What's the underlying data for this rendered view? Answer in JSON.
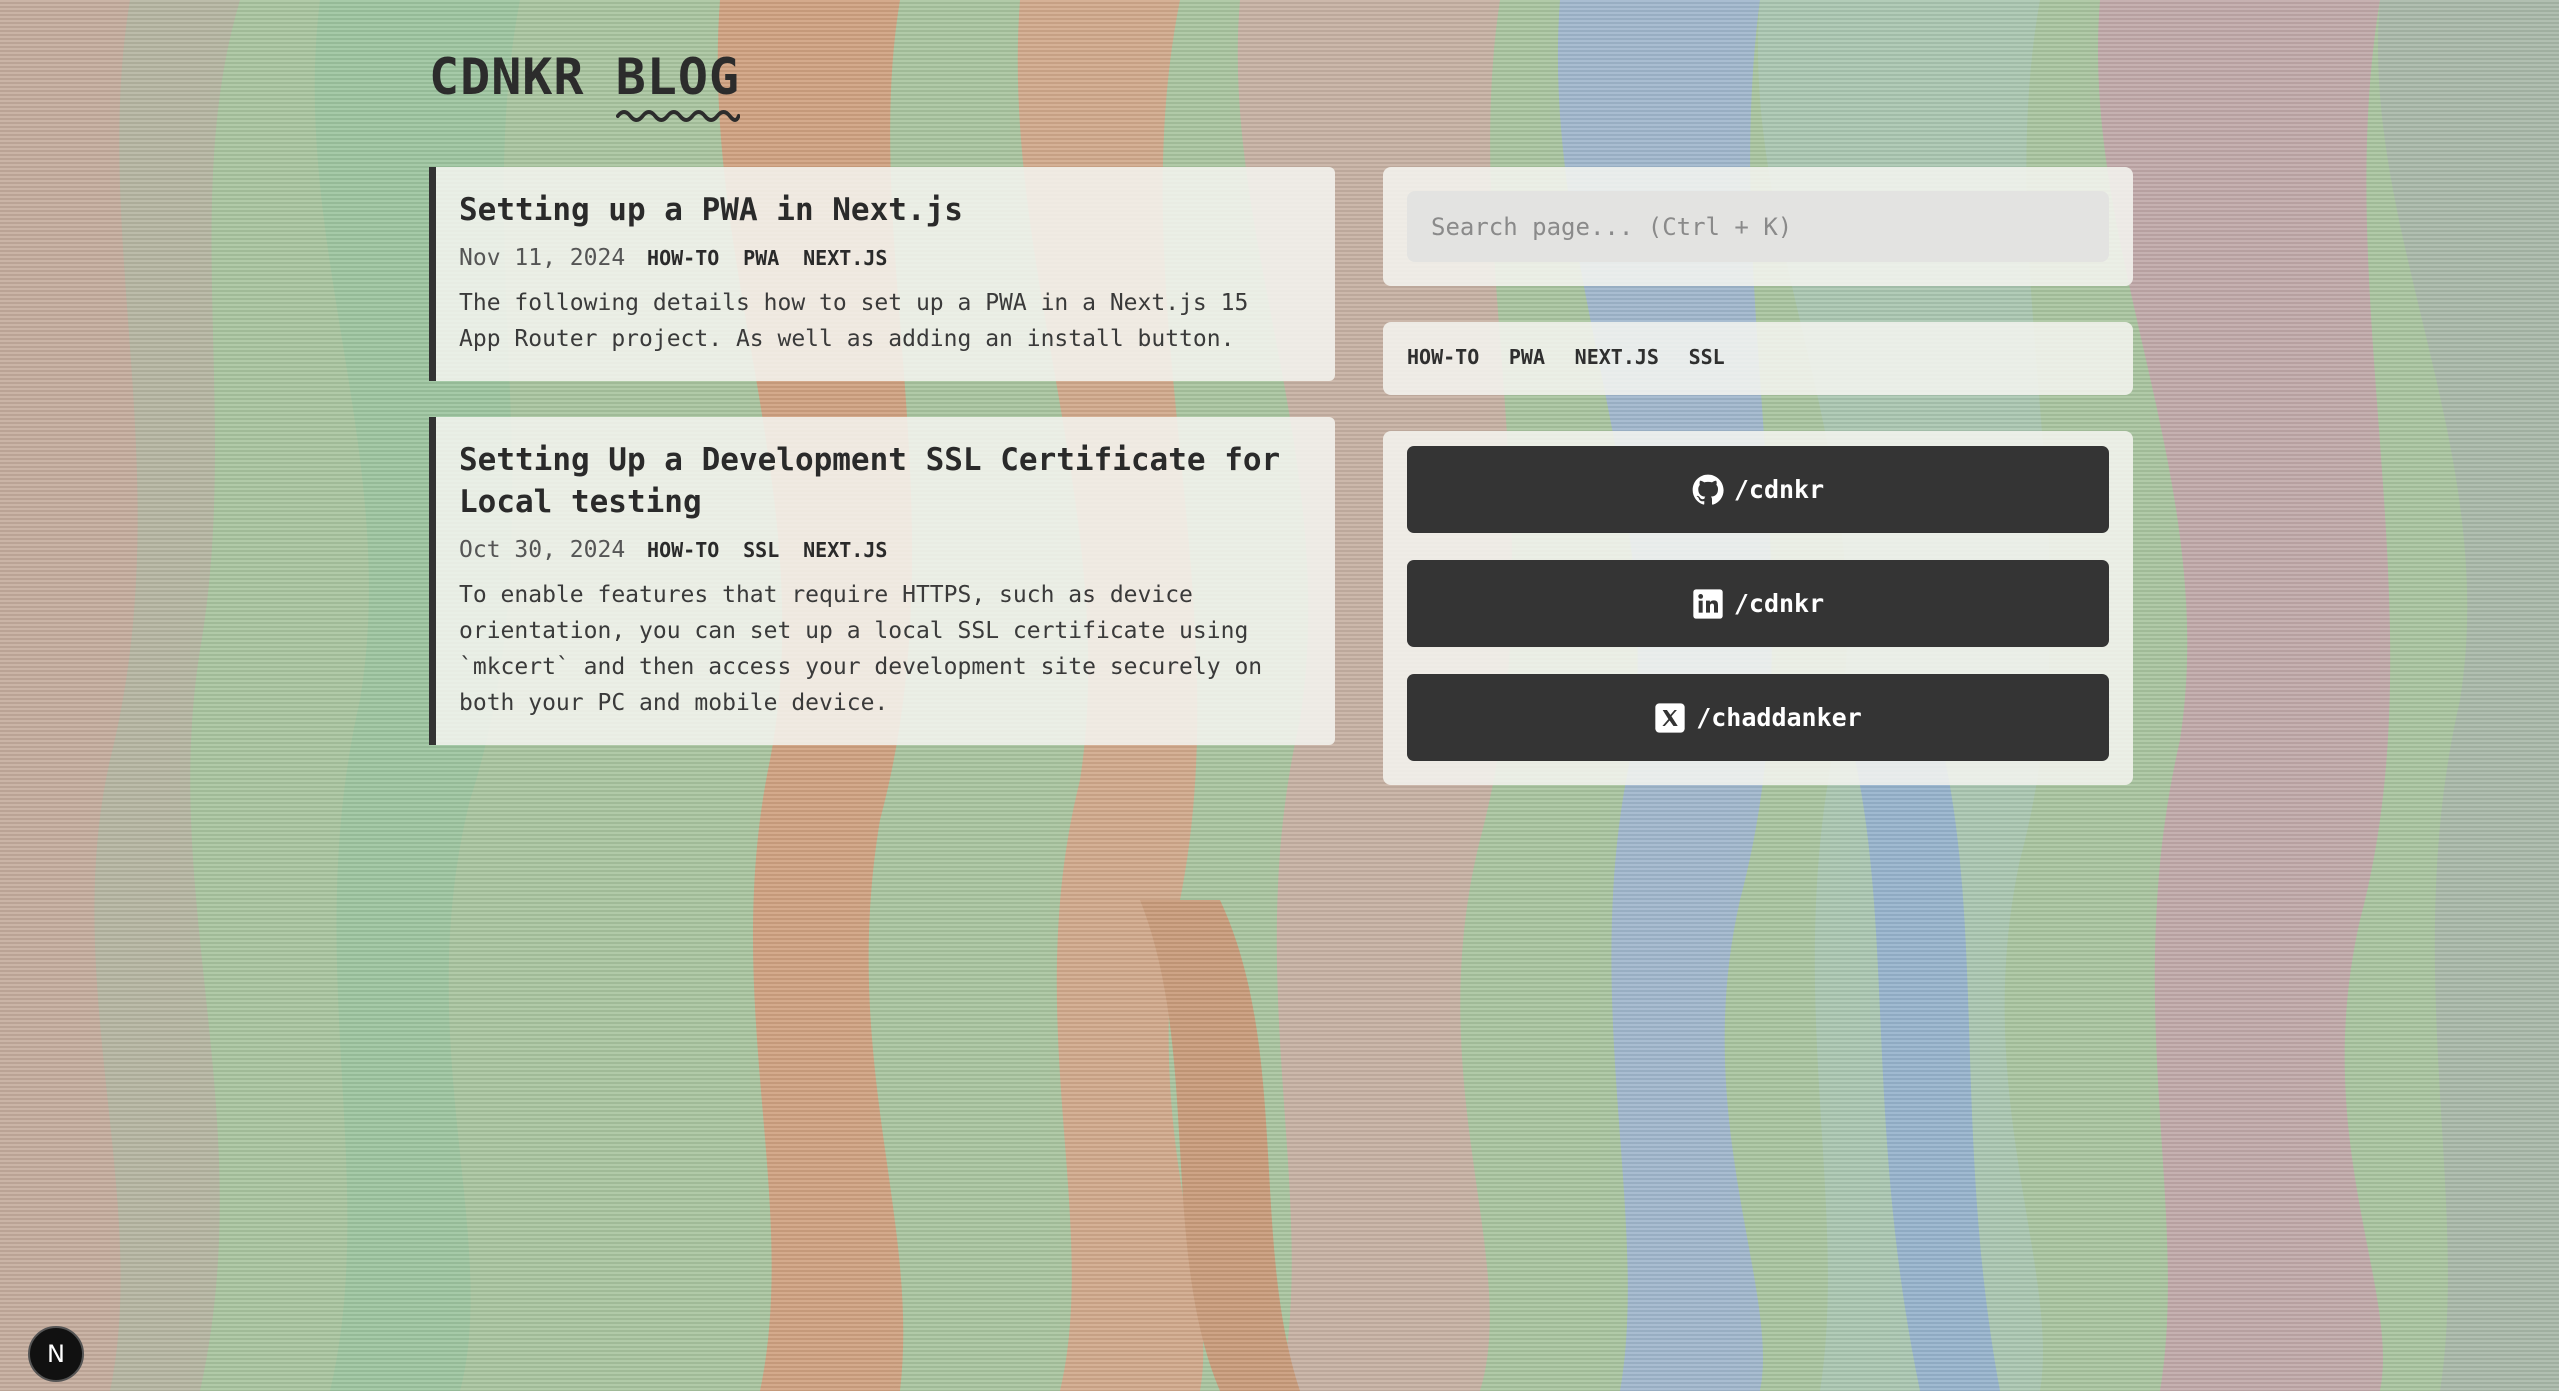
{
  "site": {
    "title_word1": "CDNKR",
    "title_word2": "BLOG"
  },
  "posts": [
    {
      "title": "Setting up a PWA in Next.js",
      "date": "Nov 11, 2024",
      "tags": [
        "HOW-TO",
        "PWA",
        "NEXT.JS"
      ],
      "description": "The following details how to set up a PWA in a Next.js 15 App Router project. As well as adding an install button."
    },
    {
      "title": "Setting Up a Development SSL Certificate for Local testing",
      "date": "Oct 30, 2024",
      "tags": [
        "HOW-TO",
        "SSL",
        "NEXT.JS"
      ],
      "description": "To enable features that require HTTPS, such as device orientation, you can set up a local SSL certificate using `mkcert` and then access your development site securely on both your PC and mobile device."
    }
  ],
  "search": {
    "placeholder": "Search page... (Ctrl + K)"
  },
  "tag_cloud": [
    "HOW-TO",
    "PWA",
    "NEXT.JS",
    "SSL"
  ],
  "social": [
    {
      "icon": "github-icon",
      "label": "/cdnkr"
    },
    {
      "icon": "linkedin-icon",
      "label": "/cdnkr"
    },
    {
      "icon": "x-icon",
      "label": "/chaddanker"
    }
  ],
  "next_badge": {
    "letter": "N"
  },
  "colors": {
    "card_bg": "#f4f4f0",
    "accent_dark": "#343434",
    "text": "#2b2b2b"
  }
}
